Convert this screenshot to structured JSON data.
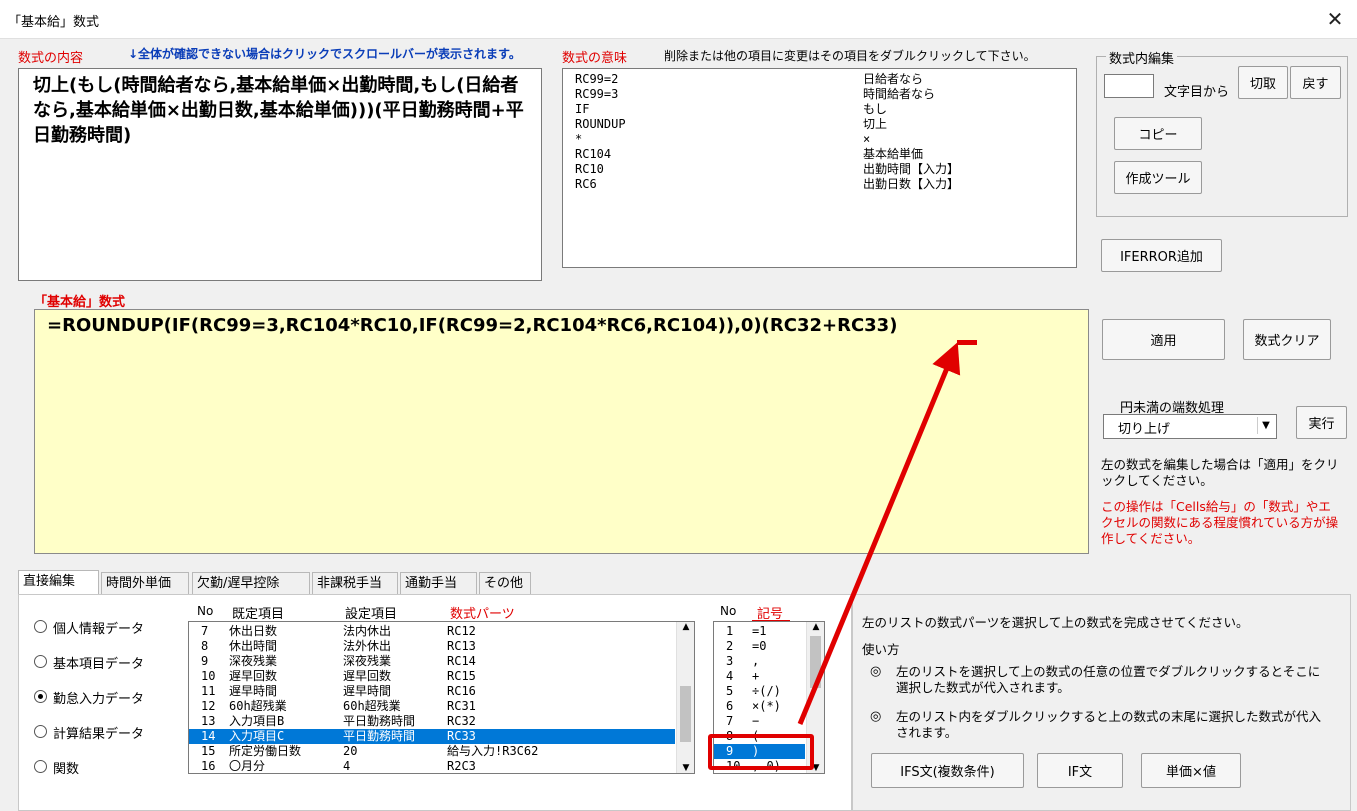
{
  "window": {
    "title": "「基本給」数式"
  },
  "formula_content": {
    "label": "数式の内容",
    "hint": "↓全体が確認できない場合はクリックでスクロールバーが表示されます。",
    "text": "切上(もし(時間給者なら,基本給単価×出勤時間,もし(日給者なら,基本給単価×出勤日数,基本給単価)))(平日勤務時間+平日勤務時間)"
  },
  "formula_meaning": {
    "label": "数式の意味",
    "hint": "削除または他の項目に変更はその項目をダブルクリックして下さい。",
    "rows": [
      {
        "code": "RC99=2",
        "meaning": "日給者なら"
      },
      {
        "code": "RC99=3",
        "meaning": "時間給者なら"
      },
      {
        "code": "IF",
        "meaning": "もし"
      },
      {
        "code": "ROUNDUP",
        "meaning": "切上"
      },
      {
        "code": "*",
        "meaning": "×"
      },
      {
        "code": "RC104",
        "meaning": "基本給単価"
      },
      {
        "code": "RC10",
        "meaning": "出勤時間【入力】"
      },
      {
        "code": "RC6",
        "meaning": "出勤日数【入力】"
      }
    ]
  },
  "edit_group": {
    "title": "数式内編集",
    "char_pos_value": "",
    "char_pos_suffix": "文字目から",
    "cut": "切取",
    "undo": "戻す",
    "copy": "コピー",
    "tool": "作成ツール"
  },
  "iferror_button": "IFERROR追加",
  "formula_editor": {
    "label": "「基本給」数式",
    "value": "=ROUNDUP(IF(RC99=3,RC104*RC10,IF(RC99=2,RC104*RC6,RC104)),0)(RC32+RC33)"
  },
  "apply_button": "適用",
  "clear_button": "数式クリア",
  "rounding": {
    "label": "円未満の端数処理",
    "selected": "切り上げ",
    "run": "実行"
  },
  "notes": {
    "apply_note": "左の数式を編集した場合は「適用」をクリックしてください。",
    "warning": "この操作は「Cells給与」の「数式」やエクセルの関数にある程度慣れている方が操作してください。"
  },
  "tabs": [
    "直接編集",
    "時間外単価",
    "欠勤/遅早控除",
    "非課税手当",
    "通勤手当",
    "その他"
  ],
  "radios": [
    {
      "label": "個人情報データ",
      "checked": false
    },
    {
      "label": "基本項目データ",
      "checked": false
    },
    {
      "label": "勤怠入力データ",
      "checked": true
    },
    {
      "label": "計算結果データ",
      "checked": false
    },
    {
      "label": "関数",
      "checked": false
    }
  ],
  "parts_list": {
    "headers": {
      "no": "No",
      "default": "既定項目",
      "setting": "設定項目",
      "parts": "数式パーツ"
    },
    "rows": [
      {
        "no": "7",
        "default": "休出日数",
        "setting": "法内休出",
        "parts": "RC12",
        "selected": false
      },
      {
        "no": "8",
        "default": "休出時間",
        "setting": "法外休出",
        "parts": "RC13",
        "selected": false
      },
      {
        "no": "9",
        "default": "深夜残業",
        "setting": "深夜残業",
        "parts": "RC14",
        "selected": false
      },
      {
        "no": "10",
        "default": "遅早回数",
        "setting": "遅早回数",
        "parts": "RC15",
        "selected": false
      },
      {
        "no": "11",
        "default": "遅早時間",
        "setting": "遅早時間",
        "parts": "RC16",
        "selected": false
      },
      {
        "no": "12",
        "default": "60h超残業",
        "setting": "60h超残業",
        "parts": "RC31",
        "selected": false
      },
      {
        "no": "13",
        "default": "入力項目B",
        "setting": "平日勤務時間",
        "parts": "RC32",
        "selected": false
      },
      {
        "no": "14",
        "default": "入力項目C",
        "setting": "平日勤務時間",
        "parts": "RC33",
        "selected": true
      },
      {
        "no": "15",
        "default": "所定労働日数",
        "setting": "20",
        "parts": "給与入力!R3C62",
        "selected": false
      },
      {
        "no": "16",
        "default": "〇月分",
        "setting": "4",
        "parts": "R2C3",
        "selected": false
      }
    ]
  },
  "symbol_list": {
    "headers": {
      "no": "No",
      "symbol": "記号"
    },
    "rows": [
      {
        "no": "1",
        "sym": "=1",
        "selected": false
      },
      {
        "no": "2",
        "sym": "=0",
        "selected": false
      },
      {
        "no": "3",
        "sym": ",",
        "selected": false
      },
      {
        "no": "4",
        "sym": "+",
        "selected": false
      },
      {
        "no": "5",
        "sym": "÷(/)",
        "selected": false
      },
      {
        "no": "6",
        "sym": "×(*)",
        "selected": false
      },
      {
        "no": "7",
        "sym": "−",
        "selected": false
      },
      {
        "no": "8",
        "sym": "(",
        "selected": false
      },
      {
        "no": "9",
        "sym": ")",
        "selected": true
      },
      {
        "no": "10",
        "sym": ", 0)",
        "selected": false
      }
    ]
  },
  "help": {
    "intro": "左のリストの数式パーツを選択して上の数式を完成させてください。",
    "usage_title": "使い方",
    "bullet1": "左のリストを選択して上の数式の任意の位置でダブルクリックするとそこに選択した数式が代入されます。",
    "bullet2": "左のリスト内をダブルクリックすると上の数式の末尾に選択した数式が代入されます。",
    "bullet_mark": "◎"
  },
  "bottom_buttons": {
    "ifs": "IFS文(複数条件)",
    "if": "IF文",
    "price_value": "単価×値"
  },
  "colors": {
    "accent_red": "#e00000",
    "selection_blue": "#0078d7",
    "editor_bg": "#ffffc8",
    "hint_blue": "#0a3db8"
  }
}
